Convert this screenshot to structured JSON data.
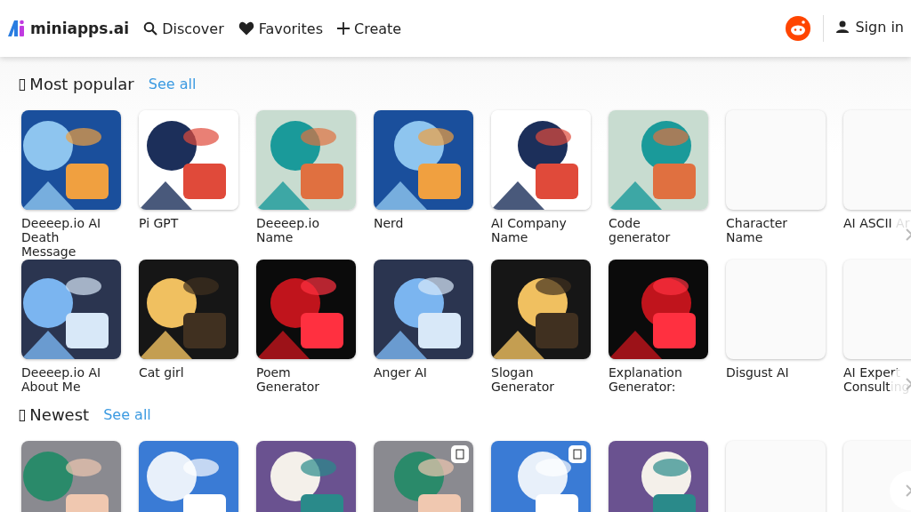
{
  "header": {
    "logo": "miniapps.ai",
    "nav": [
      {
        "kind": "search",
        "label": "Discover"
      },
      {
        "kind": "heart",
        "label": "Favorites"
      },
      {
        "kind": "plus",
        "label": "Create"
      }
    ],
    "sign_in": "Sign in"
  },
  "sections": [
    {
      "glyph": "▯",
      "title": "Most popular",
      "see_all": "See all",
      "rows": [
        [
          {
            "kind": "picture",
            "label": "Deeeep.io AI Death Message"
          },
          {
            "kind": "picture",
            "label": "Pi GPT"
          },
          {
            "kind": "picture",
            "label": "Deeeep.io Name"
          },
          {
            "kind": "picture",
            "label": "Nerd"
          },
          {
            "kind": "picture",
            "label": "AI Company Name"
          },
          {
            "kind": "picture",
            "label": "Code generator"
          },
          {
            "kind": "blank",
            "label": "Character Name"
          },
          {
            "kind": "blank",
            "label": "AI ASCII Ar"
          }
        ],
        [
          {
            "kind": "picture",
            "label": "Deeeep.io AI About Me"
          },
          {
            "kind": "picture",
            "label": "Cat girl"
          },
          {
            "kind": "picture",
            "label": "Poem Generator"
          },
          {
            "kind": "picture",
            "label": "Anger AI"
          },
          {
            "kind": "picture",
            "label": "Slogan Generator"
          },
          {
            "kind": "picture",
            "label": "Explanation Generator:"
          },
          {
            "kind": "blank",
            "label": "Disgust AI"
          },
          {
            "kind": "blank",
            "label": "AI Expert Consulting"
          }
        ]
      ]
    },
    {
      "glyph": "▯",
      "title": "Newest",
      "see_all": "See all",
      "rows": [
        [
          {
            "kind": "picture",
            "badge": false
          },
          {
            "kind": "picture",
            "badge": false
          },
          {
            "kind": "picture",
            "badge": false
          },
          {
            "kind": "picture",
            "badge": true
          },
          {
            "kind": "picture",
            "badge": true
          },
          {
            "kind": "picture",
            "badge": false
          },
          {
            "kind": "blank",
            "badge": false
          },
          {
            "kind": "blank"
          }
        ]
      ]
    }
  ]
}
